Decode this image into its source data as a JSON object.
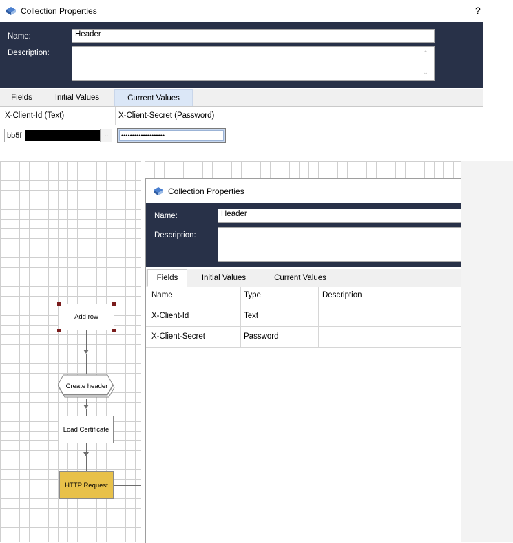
{
  "top_dialog": {
    "title": "Collection Properties",
    "help": "?",
    "name_label": "Name:",
    "name_value": "Header",
    "description_label": "Description:",
    "description_value": "",
    "tabs": [
      "Fields",
      "Initial Values",
      "Current Values"
    ],
    "active_tab": "Current Values",
    "columns": [
      "X-Client-Id  (Text)",
      "X-Client-Secret  (Password)"
    ],
    "client_id_value": "bb5f",
    "client_id_button": "..",
    "client_secret_value": "••••••••••••••••••••"
  },
  "canvas": {
    "nodes": [
      {
        "label": "Add row"
      },
      {
        "label": "Create header"
      },
      {
        "label": "Load Certificate"
      },
      {
        "label": "HTTP Request"
      }
    ],
    "accent_color": "#e8c14a"
  },
  "inner_dialog": {
    "title": "Collection Properties",
    "name_label": "Name:",
    "name_value": "Header",
    "description_label": "Description:",
    "tabs": [
      "Fields",
      "Initial Values",
      "Current Values"
    ],
    "active_tab": "Fields",
    "table": {
      "headers": [
        "Name",
        "Type",
        "Description"
      ],
      "rows": [
        [
          "X-Client-Id",
          "Text",
          ""
        ],
        [
          "X-Client-Secret",
          "Password",
          ""
        ]
      ]
    }
  },
  "colors": {
    "navy": "#283148",
    "tab_active": "#dbe7f7"
  }
}
